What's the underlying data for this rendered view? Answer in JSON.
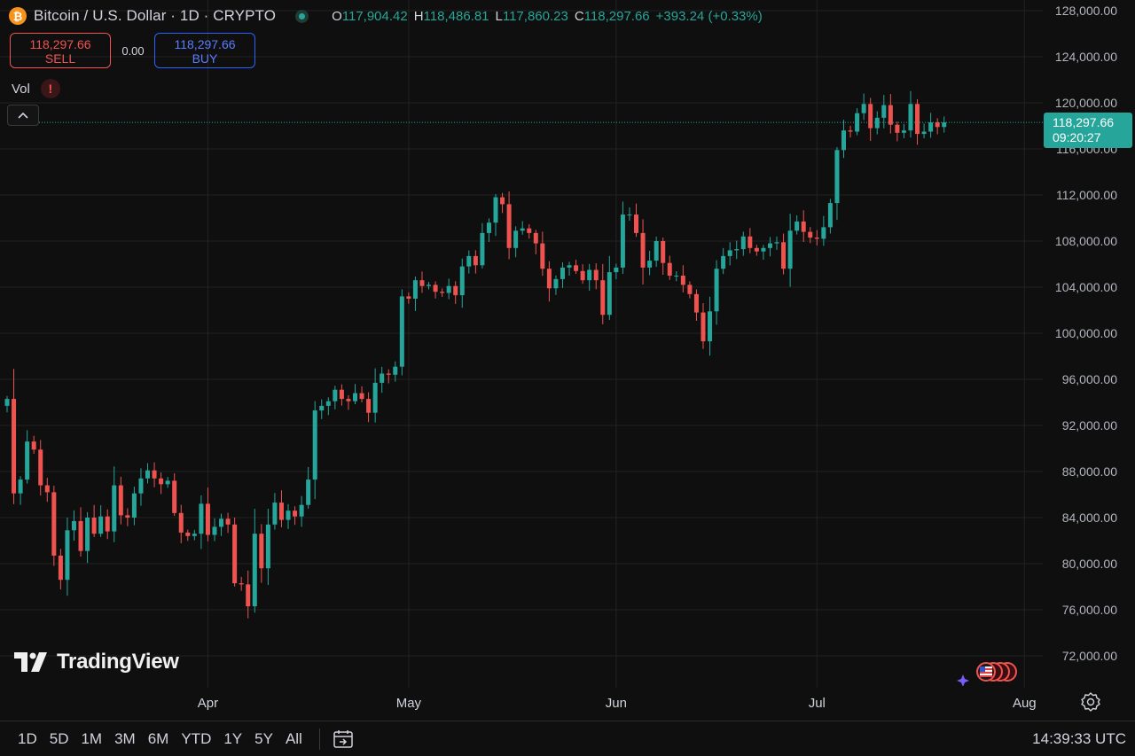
{
  "header": {
    "coin_icon": "bitcoin-icon",
    "coin_icon_glyph": "₿",
    "title": "Bitcoin / U.S. Dollar · 1D · CRYPTO",
    "ohlc": [
      {
        "key": "O",
        "value": "117,904.42"
      },
      {
        "key": "H",
        "value": "118,486.81"
      },
      {
        "key": "L",
        "value": "117,860.23"
      },
      {
        "key": "C",
        "value": "118,297.66"
      }
    ],
    "change": "+393.24 (+0.33%)"
  },
  "trade": {
    "sell_price": "118,297.66",
    "sell_label": "SELL",
    "spread": "0.00",
    "buy_price": "118,297.66",
    "buy_label": "BUY"
  },
  "volume": {
    "label": "Vol",
    "warning_glyph": "!"
  },
  "last_price": {
    "price": "118,297.66",
    "countdown": "09:20:27"
  },
  "brand": {
    "name": "TradingView"
  },
  "bottom": {
    "ranges": [
      "1D",
      "5D",
      "1M",
      "3M",
      "6M",
      "YTD",
      "1Y",
      "5Y",
      "All"
    ],
    "clock": "14:39:33 UTC"
  },
  "colors": {
    "up": "#26a69a",
    "down": "#ef5350",
    "background": "#0f0f0f",
    "grid": "#222222",
    "text": "#d1d4dc"
  },
  "chart_data": {
    "type": "candlestick",
    "title": "Bitcoin / U.S. Dollar · 1D · CRYPTO",
    "ylim": [
      69000,
      129000
    ],
    "y_ticks": [
      72000,
      76000,
      80000,
      84000,
      88000,
      92000,
      96000,
      100000,
      104000,
      108000,
      112000,
      116000,
      120000,
      124000,
      128000
    ],
    "y_tick_labels": [
      "72,000.00",
      "76,000.00",
      "80,000.00",
      "84,000.00",
      "88,000.00",
      "92,000.00",
      "96,000.00",
      "100,000.00",
      "104,000.00",
      "108,000.00",
      "112,000.00",
      "116,000.00",
      "120,000.00",
      "124,000.00",
      "128,000.00"
    ],
    "x_ticks": [
      {
        "label": "Apr",
        "date": "2025-04-01"
      },
      {
        "label": "May",
        "date": "2025-05-01"
      },
      {
        "label": "Jun",
        "date": "2025-06-01"
      },
      {
        "label": "Jul",
        "date": "2025-07-01"
      },
      {
        "label": "Aug",
        "date": "2025-08-01"
      }
    ],
    "last_price": 118297.66,
    "grid": true,
    "x_start": "2025-03-02",
    "closes": [
      94300,
      86100,
      87300,
      90600,
      89900,
      86800,
      86200,
      80700,
      78600,
      82900,
      83700,
      81100,
      84000,
      82600,
      84100,
      82800,
      86800,
      84200,
      84000,
      86100,
      87400,
      88100,
      87400,
      86900,
      87200,
      84400,
      82700,
      82400,
      82600,
      85200,
      82500,
      83200,
      83900,
      83400,
      78300,
      78200,
      76300,
      82600,
      79600,
      83400,
      85300,
      83800,
      84600,
      84100,
      85100,
      87300,
      93300,
      93700,
      94100,
      95100,
      94300,
      94100,
      94800,
      94300,
      93100,
      95700,
      96500,
      96400,
      97100,
      103200,
      103000,
      104600,
      104100,
      104200,
      103600,
      103500,
      104100,
      103300,
      105800,
      106700,
      105900,
      108700,
      109600,
      111800,
      111200,
      107400,
      108900,
      109100,
      108700,
      107800,
      105600,
      103900,
      104700,
      105700,
      105900,
      105400,
      104600,
      105500,
      104600,
      101600,
      105300,
      105700,
      110300,
      110300,
      108700,
      105700,
      106300,
      108000,
      106100,
      105000,
      105000,
      104200,
      103400,
      101800,
      99300,
      101900,
      105600,
      106700,
      107200,
      107300,
      108400,
      107400,
      107100,
      107400,
      107800,
      107900,
      105600,
      108900,
      109700,
      108800,
      108300,
      108200,
      109200,
      111300,
      115900,
      117600,
      117500,
      119100,
      119900,
      117800,
      118700,
      119800,
      118100,
      117400,
      117600,
      119900,
      117300,
      117500,
      118300,
      117900,
      118300
    ]
  }
}
